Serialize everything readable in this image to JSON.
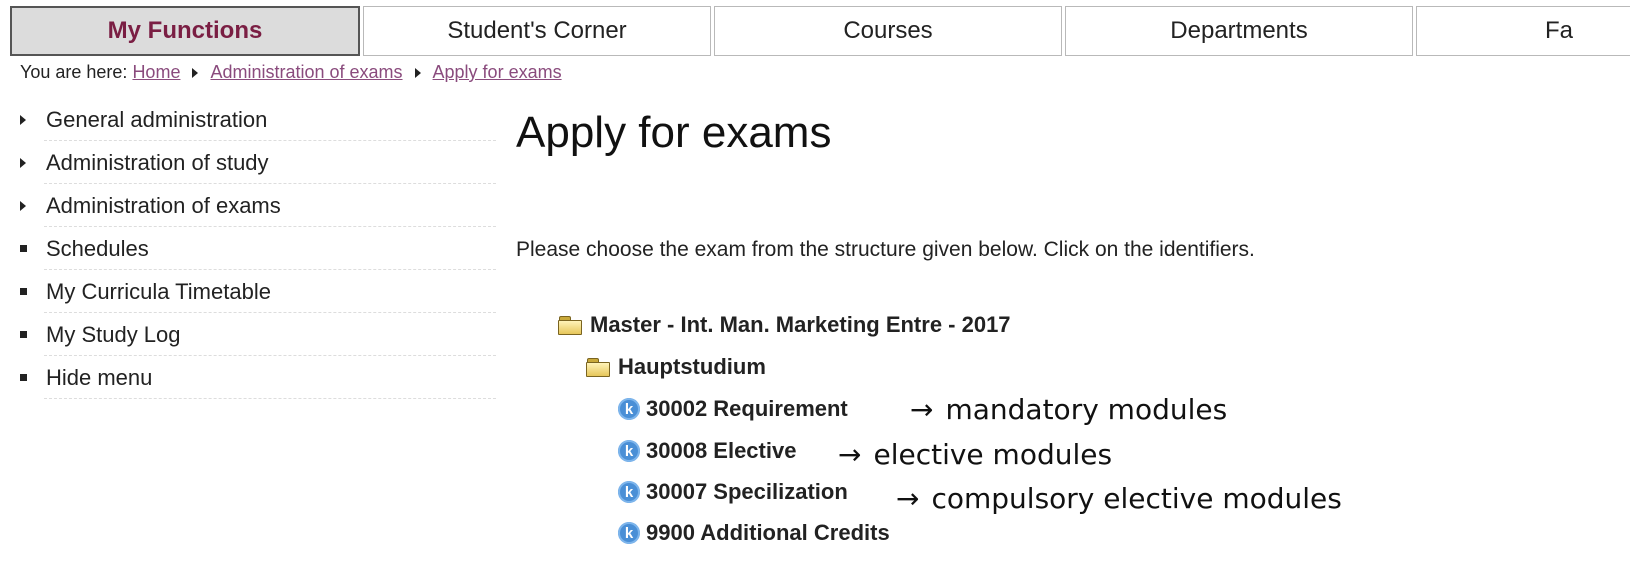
{
  "nav_tabs": [
    {
      "label": "My Functions",
      "active": true
    },
    {
      "label": "Student's Corner",
      "active": false
    },
    {
      "label": "Courses",
      "active": false
    },
    {
      "label": "Departments",
      "active": false
    },
    {
      "label": "Fa",
      "active": false
    }
  ],
  "breadcrumb": {
    "prefix": "You are here:",
    "items": [
      "Home",
      "Administration of exams",
      "Apply for exams"
    ]
  },
  "sidebar": {
    "items": [
      {
        "label": "General administration",
        "marker": "triangle"
      },
      {
        "label": "Administration of study",
        "marker": "triangle"
      },
      {
        "label": "Administration of exams",
        "marker": "triangle"
      },
      {
        "label": "Schedules",
        "marker": "square"
      },
      {
        "label": "My Curricula Timetable",
        "marker": "square"
      },
      {
        "label": "My Study Log",
        "marker": "square"
      },
      {
        "label": "Hide menu",
        "marker": "square"
      }
    ]
  },
  "main": {
    "title": "Apply for exams",
    "intro": "Please choose the exam from the structure given below. Click on the identifiers.",
    "tree": {
      "root": "Master - Int. Man. Marketing Entre - 2017",
      "child": "Hauptstudium",
      "exams": [
        {
          "label": "30002 Requirement",
          "icon": "k"
        },
        {
          "label": "30008 Elective",
          "icon": "k"
        },
        {
          "label": "30007 Specilization",
          "icon": "k"
        },
        {
          "label": "9900 Additional Credits",
          "icon": "k"
        }
      ]
    },
    "annotations": [
      {
        "arrow": "→",
        "text": "mandatory modules"
      },
      {
        "arrow": "→",
        "text": "elective modules"
      },
      {
        "arrow": "→",
        "text": "compulsory elective modules"
      }
    ]
  },
  "colors": {
    "active_tab_text": "#7a1e43",
    "link": "#8a4b7d",
    "k_icon": "#4a8fd6"
  }
}
